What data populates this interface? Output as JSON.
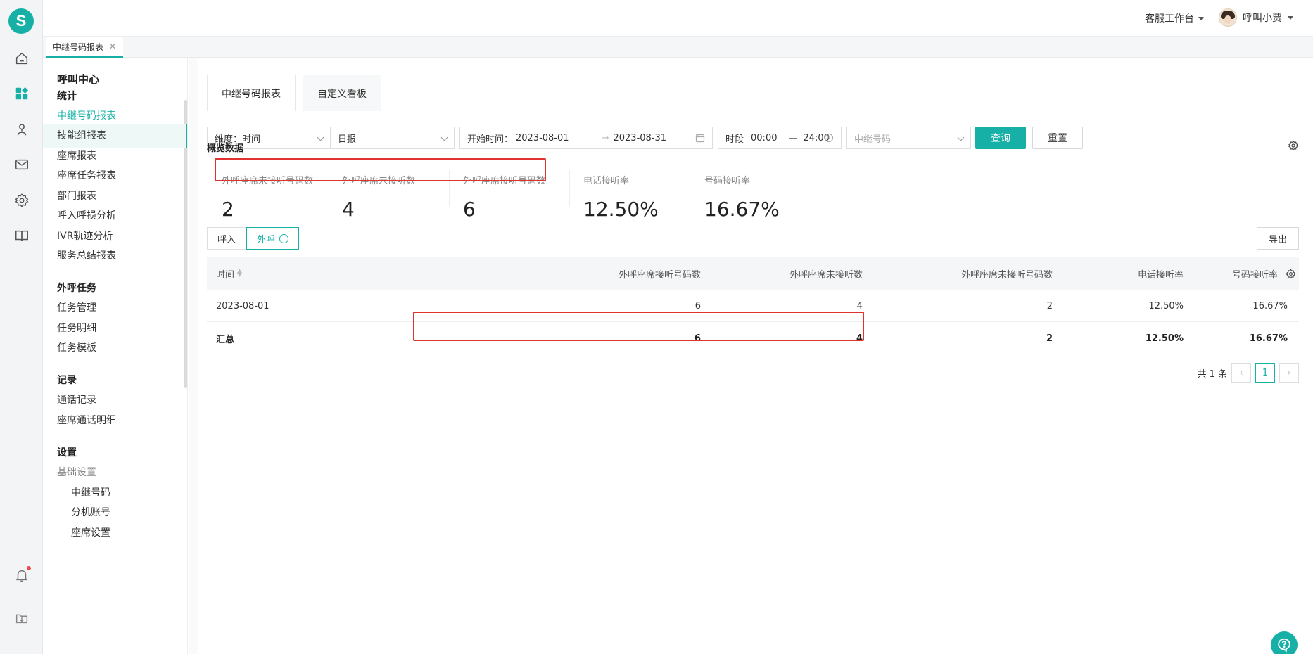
{
  "brand": {
    "logo_letter": "S",
    "accent": "#16b0a6"
  },
  "header": {
    "workbench_label": "客服工作台",
    "user_name": "呼叫小贾"
  },
  "open_tabs": [
    {
      "label": "中继号码报表"
    }
  ],
  "sidebar": {
    "title": "呼叫中心",
    "groups": {
      "stats": "统计",
      "outbound": "外呼任务",
      "records": "记录",
      "settings": "设置"
    },
    "items": {
      "trunk_report": "中继号码报表",
      "skill_group_report": "技能组报表",
      "agent_report": "座席报表",
      "agent_task_report": "座席任务报表",
      "dept_report": "部门报表",
      "inbound_loss": "呼入呼损分析",
      "ivr_trace": "IVR轨迹分析",
      "service_summary": "服务总结报表",
      "task_manage": "任务管理",
      "task_detail": "任务明细",
      "task_template": "任务模板",
      "call_records": "通话记录",
      "agent_call_detail": "座席通话明细",
      "basic_settings": "基础设置",
      "trunk_number": "中继号码",
      "extension_account": "分机账号",
      "agent_settings": "座席设置"
    }
  },
  "main": {
    "tabs": [
      "中继号码报表",
      "自定义看板"
    ],
    "filters": {
      "dimension": "维度：时间",
      "period": "日报",
      "start_label": "开始时间：",
      "start_date": "2023-08-01",
      "end_date": "2023-08-31",
      "time_label": "时段",
      "time_from": "00:00",
      "time_to": "24:00",
      "trunk_placeholder": "中继号码",
      "query_label": "查询",
      "reset_label": "重置"
    },
    "overview": {
      "title": "概览数据",
      "stats": [
        {
          "label": "外呼座席未接听号码数",
          "value": "2"
        },
        {
          "label": "外呼座席未接听数",
          "value": "4"
        },
        {
          "label": "外呼座席接听号码数",
          "value": "6"
        },
        {
          "label": "电话接听率",
          "value": "12.50%"
        },
        {
          "label": "号码接听率",
          "value": "16.67%"
        }
      ]
    },
    "direction": {
      "inbound": "呼入",
      "outbound": "外呼"
    },
    "export_label": "导出",
    "table": {
      "columns": [
        "时间",
        "外呼座席接听号码数",
        "外呼座席未接听数",
        "外呼座席未接听号码数",
        "电话接听率",
        "号码接听率"
      ],
      "rows": [
        [
          "2023-08-01",
          "6",
          "4",
          "2",
          "12.50%",
          "16.67%"
        ]
      ],
      "total": [
        "汇总",
        "6",
        "4",
        "2",
        "12.50%",
        "16.67%"
      ]
    },
    "pagination": {
      "total_text": "共 1 条",
      "current_page": "1"
    }
  }
}
